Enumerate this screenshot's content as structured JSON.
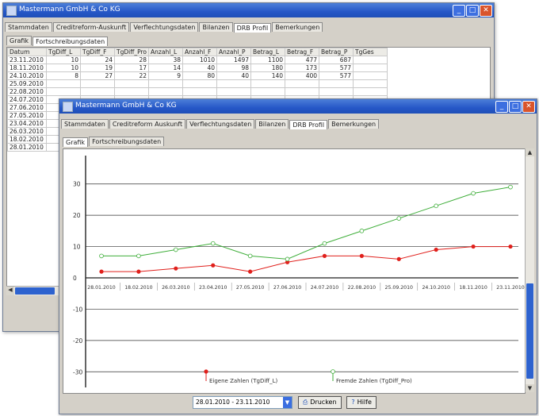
{
  "back_window": {
    "title": "Mastermann GmbH & Co KG",
    "tabs": [
      "Stammdaten",
      "Creditreform-Auskunft",
      "Verflechtungsdaten",
      "Bilanzen",
      "DRB Profil",
      "Bemerkungen"
    ],
    "active_tab": 4,
    "subtabs": [
      "Grafik",
      "Fortschreibungsdaten"
    ],
    "active_subtab": 1,
    "columns": [
      "Datum",
      "TgDiff_L",
      "TgDiff_F",
      "TgDiff_Pro",
      "Anzahl_L",
      "Anzahl_F",
      "Anzahl_P",
      "Betrag_L",
      "Betrag_F",
      "Betrag_P",
      "TgGes"
    ],
    "rows": [
      [
        "23.11.2010",
        "10",
        "24",
        "28",
        "38",
        "1010",
        "1497",
        "1100",
        "477",
        "687",
        ""
      ],
      [
        "18.11.2010",
        "10",
        "19",
        "17",
        "14",
        "40",
        "98",
        "180",
        "173",
        "577",
        ""
      ],
      [
        "24.10.2010",
        "8",
        "27",
        "22",
        "9",
        "80",
        "40",
        "140",
        "400",
        "577",
        ""
      ],
      [
        "25.09.2010",
        "",
        "",
        "",
        "",
        "",
        "",
        "",
        "",
        "",
        ""
      ],
      [
        "22.08.2010",
        "",
        "",
        "",
        "",
        "",
        "",
        "",
        "",
        "",
        ""
      ],
      [
        "24.07.2010",
        "",
        "",
        "",
        "",
        "",
        "",
        "",
        "",
        "",
        ""
      ],
      [
        "27.06.2010",
        "",
        "",
        "",
        "",
        "",
        "",
        "",
        "",
        "",
        ""
      ],
      [
        "27.05.2010",
        "",
        "",
        "",
        "",
        "",
        "",
        "",
        "",
        "",
        ""
      ],
      [
        "23.04.2010",
        "",
        "",
        "",
        "",
        "",
        "",
        "",
        "",
        "",
        ""
      ],
      [
        "26.03.2010",
        "",
        "",
        "",
        "",
        "",
        "",
        "",
        "",
        "",
        ""
      ],
      [
        "18.02.2010",
        "",
        "",
        "",
        "",
        "",
        "",
        "",
        "",
        "",
        ""
      ],
      [
        "28.01.2010",
        "",
        "",
        "",
        "",
        "",
        "",
        "",
        "",
        "",
        ""
      ]
    ]
  },
  "front_window": {
    "title": "Mastermann GmbH & Co KG",
    "tabs": [
      "Stammdaten",
      "Creditreform Auskunft",
      "Verflechtungsdaten",
      "Bilanzen",
      "DRB Profil",
      "Bemerkungen"
    ],
    "active_tab": 4,
    "subtabs": [
      "Grafik",
      "Fortschreibungsdaten"
    ],
    "active_subtab": 0,
    "range_select": "28.01.2010 - 23.11.2010",
    "print_button": "Drucken",
    "help_button": "Hilfe"
  },
  "chart_data": {
    "type": "line",
    "x": [
      "28.01.2010",
      "18.02.2010",
      "26.03.2010",
      "23.04.2010",
      "27.05.2010",
      "27.06.2010",
      "24.07.2010",
      "22.08.2010",
      "25.09.2010",
      "24.10.2010",
      "18.11.2010",
      "23.11.2010"
    ],
    "x_tick_labels": [
      "28.01.2010",
      "18.02.2010",
      "26.03.2010",
      "23.04.2010",
      "27.05.2010",
      "27.06.2010",
      "24.07.2010",
      "22.08.2010",
      "25.09.2010",
      "24.10.2010",
      "18.11.2010",
      "23.11.2010"
    ],
    "series": [
      {
        "name": "Eigene Zahlen (TgDiff_L)",
        "color": "#e0201c",
        "values": [
          2,
          2,
          3,
          4,
          2,
          5,
          7,
          7,
          6,
          9,
          10,
          10
        ]
      },
      {
        "name": "Fremde Zahlen (TgDiff_Pro)",
        "color": "#3fae3a",
        "values": [
          7,
          7,
          9,
          11,
          7,
          6,
          11,
          15,
          19,
          23,
          27,
          29
        ]
      }
    ],
    "ylim": [
      -35,
      35
    ],
    "yticks": [
      30,
      20,
      10,
      0,
      -10,
      -20,
      -30
    ],
    "grid": true,
    "legend_position": "bottom"
  },
  "colors": {
    "titlebar": "#2657c7",
    "accent": "#2d62cf",
    "close": "#d9542b"
  }
}
